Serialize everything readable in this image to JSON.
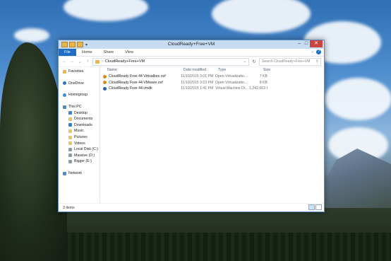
{
  "window": {
    "title": "CloudReady+Free+VM",
    "ribbon_tabs": [
      "File",
      "Home",
      "Share",
      "View"
    ],
    "help_label": "?"
  },
  "address": {
    "path_segment": "CloudReady+Free+VM",
    "search_placeholder": "Search CloudReady+Free+VM"
  },
  "nav_pane": [
    {
      "label": "Favorites",
      "icon": "star-icon"
    },
    {
      "label": "OneDrive",
      "icon": "cloud-icon"
    },
    {
      "label": "Homegroup",
      "icon": "homegroup-icon"
    },
    {
      "label": "This PC",
      "icon": "computer-icon"
    },
    {
      "label": "Desktop",
      "icon": "desktop-icon"
    },
    {
      "label": "Documents",
      "icon": "documents-icon"
    },
    {
      "label": "Downloads",
      "icon": "downloads-icon"
    },
    {
      "label": "Music",
      "icon": "music-icon"
    },
    {
      "label": "Pictures",
      "icon": "pictures-icon"
    },
    {
      "label": "Videos",
      "icon": "videos-icon"
    },
    {
      "label": "Local Disk (C:)",
      "icon": "drive-icon"
    },
    {
      "label": "Massive (D:)",
      "icon": "drive-icon"
    },
    {
      "label": "Bigger (E:)",
      "icon": "drive-icon"
    },
    {
      "label": "Network",
      "icon": "network-icon"
    }
  ],
  "columns": {
    "name": "Name",
    "date": "Date modified",
    "type": "Type",
    "size": "Size"
  },
  "files": [
    {
      "name": "CloudReady Free 44 Virtualbox.ovf",
      "date": "11/10/2015 3:01 PM",
      "type": "Open Virtualizatio...",
      "size": "7 KB",
      "icon": "ovf-icon"
    },
    {
      "name": "CloudReady Free 44 VMware.ovf",
      "date": "11/10/2015 3:23 PM",
      "type": "Open Virtualizatio...",
      "size": "8 KB",
      "icon": "ovf-icon"
    },
    {
      "name": "CloudReady Free 44.vmdk",
      "date": "11/10/2015 1:41 PM",
      "type": "Virtual Machine Di...",
      "size": "1,242,663 KB",
      "icon": "vmdk-icon"
    }
  ],
  "status": {
    "item_count": "3 items"
  },
  "colors": {
    "accent": "#1e6fc4",
    "selection": "#cce4f7",
    "close_button": "#c9463d"
  }
}
